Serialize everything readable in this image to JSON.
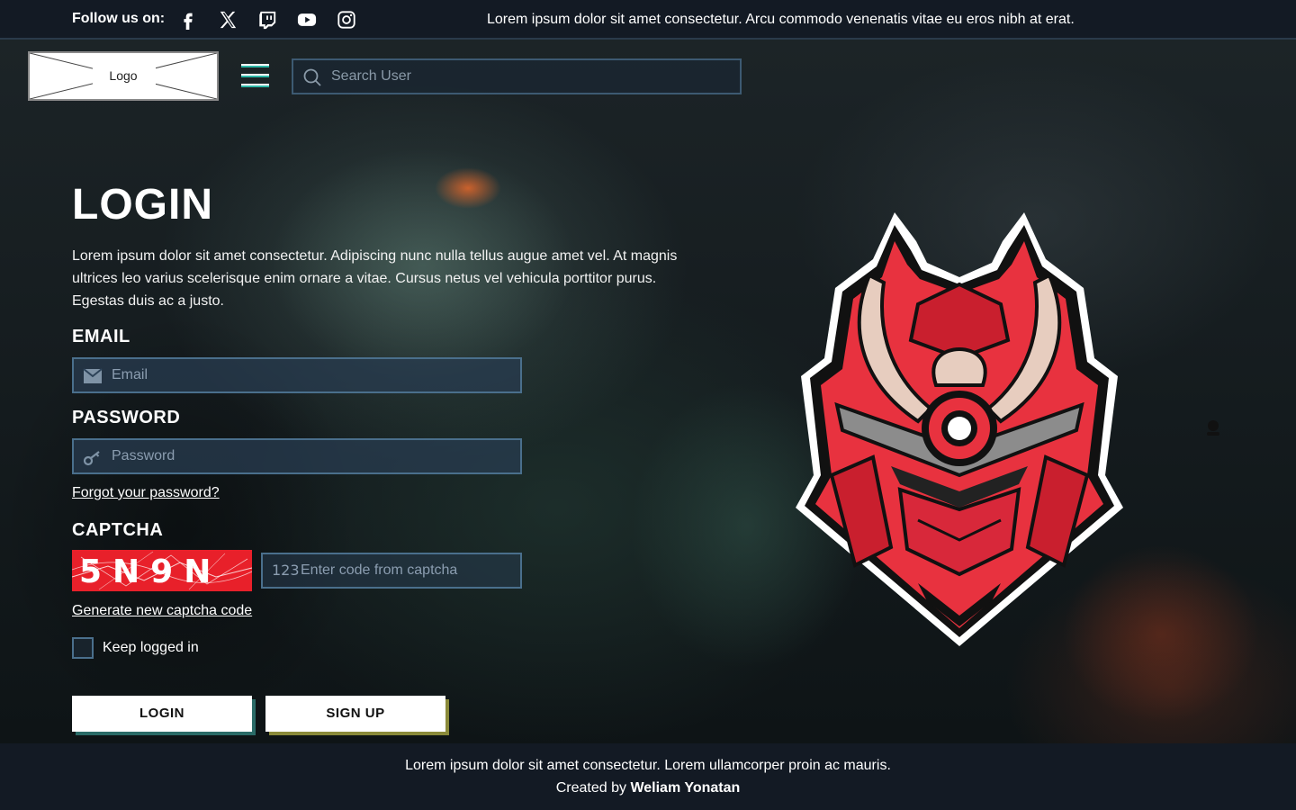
{
  "topbar": {
    "follow_label": "Follow us on:",
    "socials": [
      "facebook-icon",
      "x-icon",
      "twitch-icon",
      "youtube-icon",
      "instagram-icon"
    ],
    "marquee": "Lorem ipsum dolor sit amet consectetur. Arcu commodo venenatis vitae eu eros nibh at erat."
  },
  "header": {
    "logo_label": "Logo",
    "search_placeholder": "Search User"
  },
  "login": {
    "title": "LOGIN",
    "description": "Lorem ipsum dolor sit amet consectetur. Adipiscing nunc nulla tellus augue amet vel. At magnis ultrices leo varius scelerisque enim ornare a vitae. Cursus netus vel vehicula porttitor purus. Egestas duis ac a justo.",
    "email_label": "EMAIL",
    "email_placeholder": "Email",
    "password_label": "PASSWORD",
    "password_placeholder": "Password",
    "forgot_link": "Forgot your password?",
    "captcha_label": "CAPTCHA",
    "captcha_code": "5N9N",
    "captcha_placeholder": "Enter code from captcha",
    "captcha_icon": "123",
    "new_captcha_link": "Generate new captcha code",
    "keep_logged": "Keep logged in",
    "login_button": "LOGIN",
    "signup_button": "SIGN UP"
  },
  "footer": {
    "line1": "Lorem ipsum dolor sit amet consectetur. Lorem ullamcorper proin ac mauris.",
    "created_by": "Created by",
    "author": "Weliam Yonatan"
  },
  "colors": {
    "bar_bg": "#131a24",
    "field_border": "#4a6f8c",
    "accent_teal": "#2fb8a8",
    "mascot_red": "#e8323f",
    "captcha_red": "#e8202a"
  }
}
